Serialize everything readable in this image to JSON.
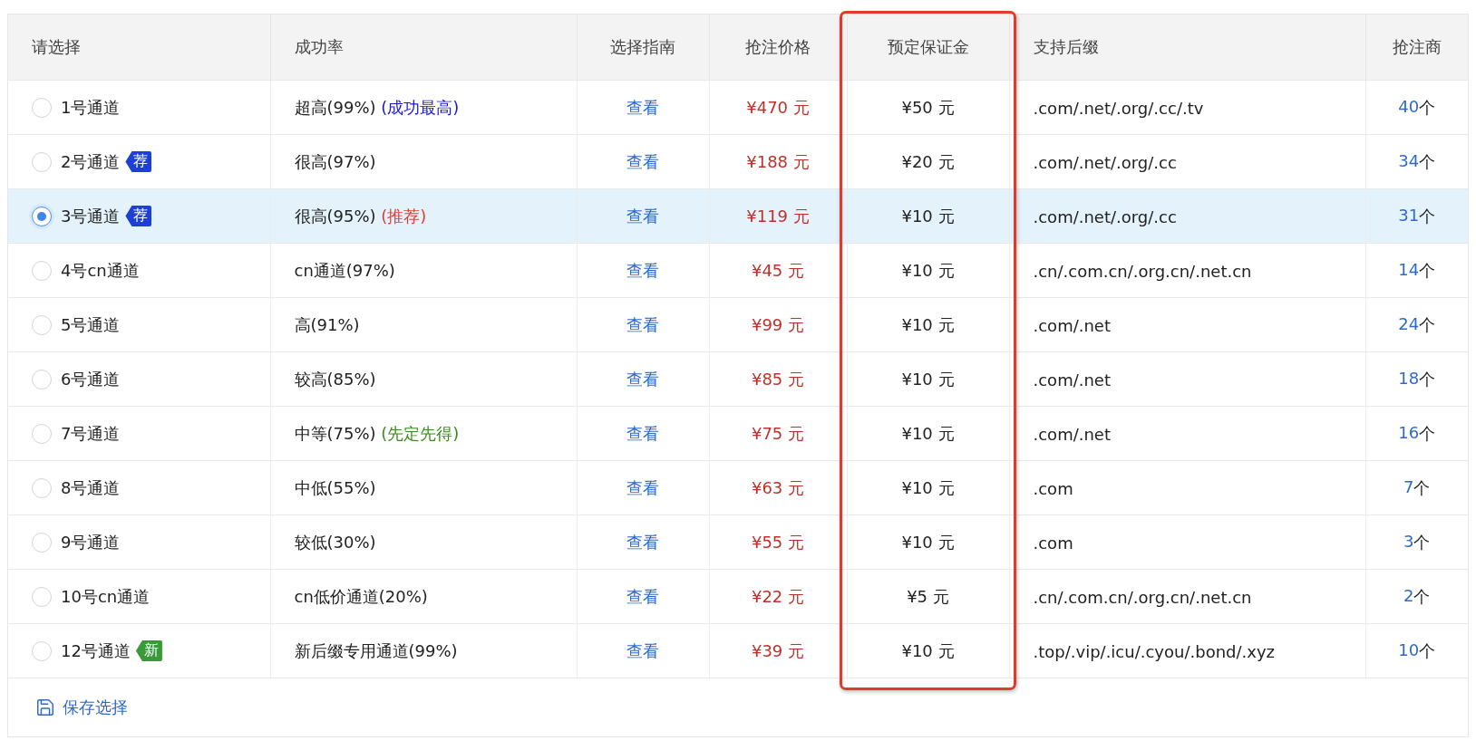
{
  "table": {
    "columns": [
      "请选择",
      "成功率",
      "选择指南",
      "抢注价格",
      "预定保证金",
      "支持后缀",
      "抢注商"
    ],
    "rows": [
      {
        "channel": "1号通道",
        "selected": false,
        "rate": "超高(99%)",
        "note": {
          "text": "(成功最高)",
          "color": "#1a1acc"
        },
        "guide": "查看",
        "price": "¥470 元",
        "deposit": "¥50 元",
        "suffixes": ".com/.net/.org/.cc/.tv",
        "count": "40",
        "unit": "个"
      },
      {
        "channel": "2号通道",
        "selected": false,
        "badge": {
          "kind": "recommend",
          "label": "荐"
        },
        "rate": "很高(97%)",
        "guide": "查看",
        "price": "¥188 元",
        "deposit": "¥20 元",
        "suffixes": ".com/.net/.org/.cc",
        "count": "34",
        "unit": "个"
      },
      {
        "channel": "3号通道",
        "selected": true,
        "badge": {
          "kind": "recommend",
          "label": "荐"
        },
        "rate": "很高(95%)",
        "note": {
          "text": "(推荐)",
          "color": "#d9412f"
        },
        "guide": "查看",
        "price": "¥119 元",
        "deposit": "¥10 元",
        "suffixes": ".com/.net/.org/.cc",
        "count": "31",
        "unit": "个"
      },
      {
        "channel": "4号cn通道",
        "selected": false,
        "rate": "cn通道(97%)",
        "guide": "查看",
        "price": "¥45 元",
        "deposit": "¥10 元",
        "suffixes": ".cn/.com.cn/.org.cn/.net.cn",
        "count": "14",
        "unit": "个"
      },
      {
        "channel": "5号通道",
        "selected": false,
        "rate": "高(91%)",
        "guide": "查看",
        "price": "¥99 元",
        "deposit": "¥10 元",
        "suffixes": ".com/.net",
        "count": "24",
        "unit": "个"
      },
      {
        "channel": "6号通道",
        "selected": false,
        "rate": "较高(85%)",
        "guide": "查看",
        "price": "¥85 元",
        "deposit": "¥10 元",
        "suffixes": ".com/.net",
        "count": "18",
        "unit": "个"
      },
      {
        "channel": "7号通道",
        "selected": false,
        "rate": "中等(75%)",
        "note": {
          "text": "(先定先得)",
          "color": "#3b8a1e"
        },
        "guide": "查看",
        "price": "¥75 元",
        "deposit": "¥10 元",
        "suffixes": ".com/.net",
        "count": "16",
        "unit": "个"
      },
      {
        "channel": "8号通道",
        "selected": false,
        "rate": "中低(55%)",
        "guide": "查看",
        "price": "¥63 元",
        "deposit": "¥10 元",
        "suffixes": ".com",
        "count": "7",
        "unit": "个"
      },
      {
        "channel": "9号通道",
        "selected": false,
        "rate": "较低(30%)",
        "guide": "查看",
        "price": "¥55 元",
        "deposit": "¥10 元",
        "suffixes": ".com",
        "count": "3",
        "unit": "个"
      },
      {
        "channel": "10号cn通道",
        "selected": false,
        "rate": "cn低价通道(20%)",
        "guide": "查看",
        "price": "¥22 元",
        "deposit": "¥5 元",
        "suffixes": ".cn/.com.cn/.org.cn/.net.cn",
        "count": "2",
        "unit": "个"
      },
      {
        "channel": "12号通道",
        "selected": false,
        "badge": {
          "kind": "new",
          "label": "新"
        },
        "rate": "新后缀专用通道(99%)",
        "guide": "查看",
        "price": "¥39 元",
        "deposit": "¥10 元",
        "suffixes": ".top/.vip/.icu/.cyou/.bond/.xyz",
        "count": "10",
        "unit": "个"
      }
    ]
  },
  "save_button": "保存选择"
}
